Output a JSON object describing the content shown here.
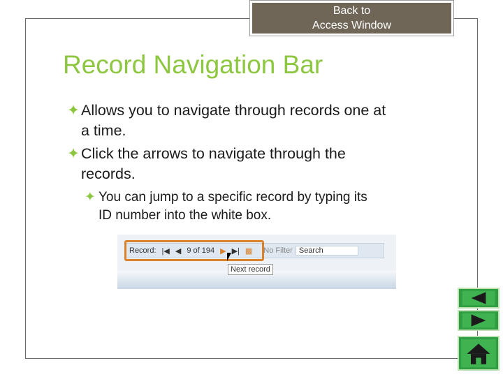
{
  "back_button": {
    "line1": "Back to",
    "line2": "Access Window"
  },
  "title": "Record Navigation Bar",
  "bullets": [
    {
      "text1": "Allows you to navigate through records one at",
      "text2": "a time."
    },
    {
      "text1": "Click the arrows to navigate through the",
      "text2": "records."
    }
  ],
  "sub_bullet": {
    "text1": "You can jump to a specific record by typing its",
    "text2": "ID number into the white box."
  },
  "screenshot": {
    "record_label": "Record:",
    "record_counter": "9 of 194",
    "filter_label": "No Filter",
    "search_label": "Search",
    "tooltip": "Next record"
  },
  "colors": {
    "title": "#8dc63f",
    "back_button_bg": "#6f6658",
    "nav_green": "#2f9e43"
  },
  "icons": [
    "bullet-icon",
    "prev-arrow-icon",
    "next-arrow-icon",
    "home-icon"
  ]
}
